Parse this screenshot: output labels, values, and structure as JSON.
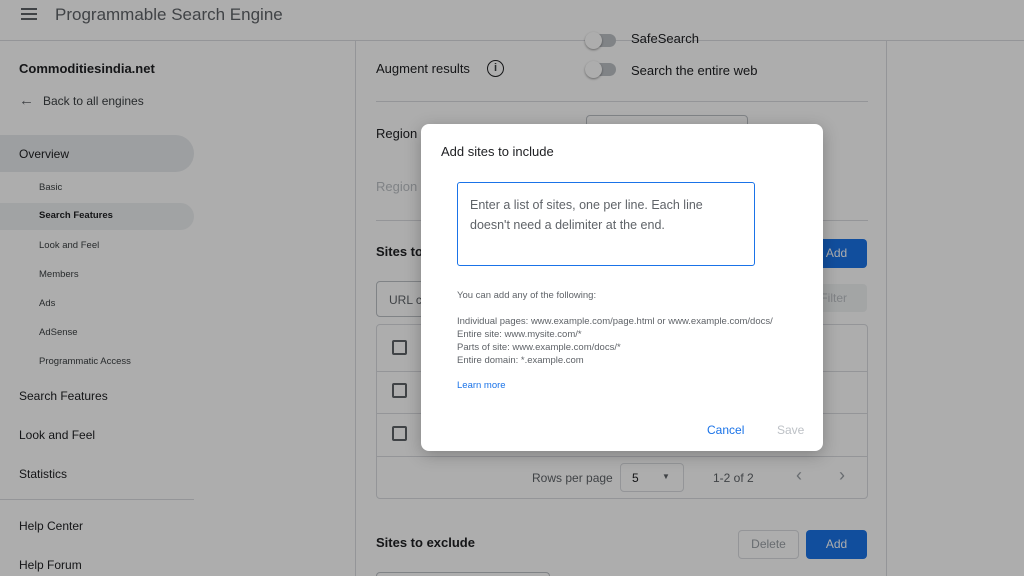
{
  "header": {
    "title": "Programmable Search Engine",
    "menu_icon": "menu-icon"
  },
  "sidebar": {
    "engine_name": "Commoditiesindia.net",
    "back_label": "Back to all engines",
    "overview": "Overview",
    "sub_items": [
      "Basic",
      "Search Features",
      "Look and Feel",
      "Members",
      "Ads",
      "AdSense",
      "Programmatic Access"
    ],
    "active_sub_item": "Search Features",
    "main_items": [
      "Search Features",
      "Look and Feel",
      "Statistics"
    ],
    "help_items": [
      "Help Center",
      "Help Forum"
    ]
  },
  "main": {
    "safesearch_label": "SafeSearch",
    "augment_label": "Augment results",
    "search_entire_web_label": "Search the entire web",
    "region_label": "Region",
    "region2_label": "Region",
    "sites_include_label": "Sites to include",
    "add_label": "Add",
    "url_placeholder": "URL contains",
    "filter_label": "Filter",
    "rows_per_page_label": "Rows per page",
    "rows_per_page_value": "5",
    "pagination_info": "1-2 of 2",
    "sites_exclude_label": "Sites to exclude",
    "delete_label": "Delete",
    "add_exclude_label": "Add"
  },
  "dialog": {
    "title": "Add sites to include",
    "textarea_placeholder": "Enter a list of sites, one per line. Each line doesn't need a delimiter at the end.",
    "hint_intro": "You can add any of the following:",
    "hint_individual": "Individual pages: www.example.com/page.html or www.example.com/docs/",
    "hint_entire_site": "Entire site: www.mysite.com/*",
    "hint_parts": "Parts of site: www.example.com/docs/*",
    "hint_domain": "Entire domain: *.example.com",
    "learn_more": "Learn more",
    "cancel": "Cancel",
    "save": "Save"
  },
  "colors": {
    "accent": "#1a73e8",
    "overlay": "rgba(0,0,0,0.32)"
  }
}
